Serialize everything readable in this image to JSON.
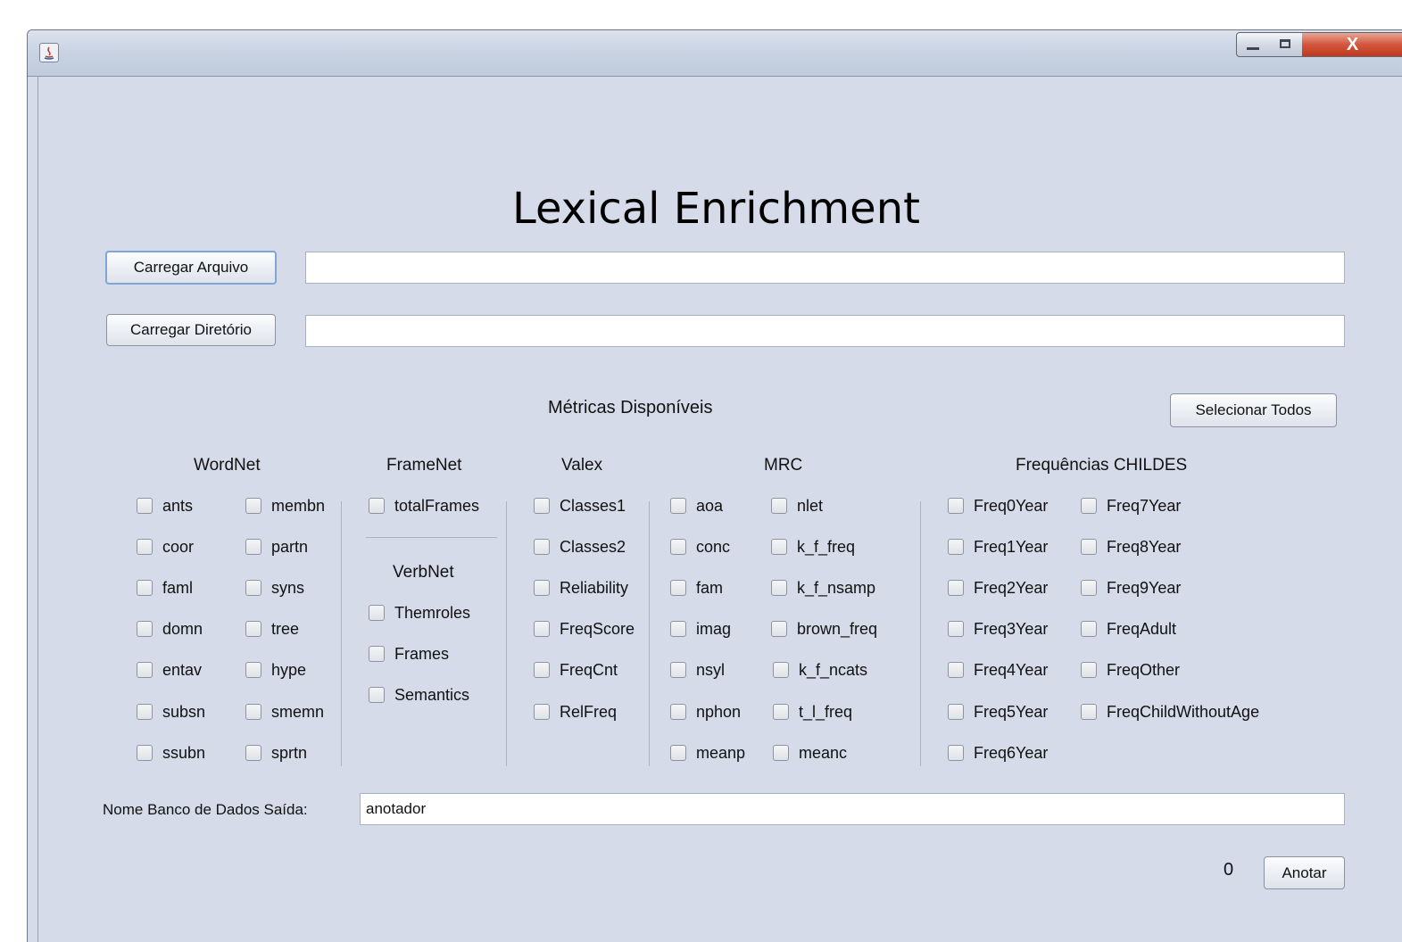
{
  "app": {
    "title": "Lexical Enrichment"
  },
  "file_row": {
    "button_label": "Carregar Arquivo",
    "value": ""
  },
  "dir_row": {
    "button_label": "Carregar Diretório",
    "value": ""
  },
  "metrics": {
    "title": "Métricas Disponíveis",
    "select_all_label": "Selecionar Todos"
  },
  "wordnet": {
    "title": "WordNet",
    "items": [
      "ants",
      "coor",
      "faml",
      "domn",
      "entav",
      "subsn",
      "ssubn",
      "membn",
      "partn",
      "syns",
      "tree",
      "hype",
      "smemn",
      "sprtn"
    ]
  },
  "framenet": {
    "title": "FrameNet",
    "items": [
      "totalFrames"
    ]
  },
  "verbnet": {
    "title": "VerbNet",
    "items": [
      "Themroles",
      "Frames",
      "Semantics"
    ]
  },
  "valex": {
    "title": "Valex",
    "items": [
      "Classes1",
      "Classes2",
      "Reliability",
      "FreqScore",
      "FreqCnt",
      "RelFreq"
    ]
  },
  "mrc": {
    "title": "MRC",
    "items": [
      "aoa",
      "conc",
      "fam",
      "imag",
      "nsyl",
      "nphon",
      "meanp",
      "nlet",
      "k_f_freq",
      "k_f_nsamp",
      "brown_freq",
      "k_f_ncats",
      "t_l_freq",
      "meanc"
    ]
  },
  "childes": {
    "title": "Frequências CHILDES",
    "items": [
      "Freq0Year",
      "Freq1Year",
      "Freq2Year",
      "Freq3Year",
      "Freq4Year",
      "Freq5Year",
      "Freq6Year",
      "Freq7Year",
      "Freq8Year",
      "Freq9Year",
      "FreqAdult",
      "FreqOther",
      "FreqChildWithoutAge"
    ]
  },
  "output": {
    "label": "Nome Banco de Dados Saída:",
    "value": "anotador"
  },
  "footer": {
    "count": "0",
    "annotate_label": "Anotar"
  }
}
